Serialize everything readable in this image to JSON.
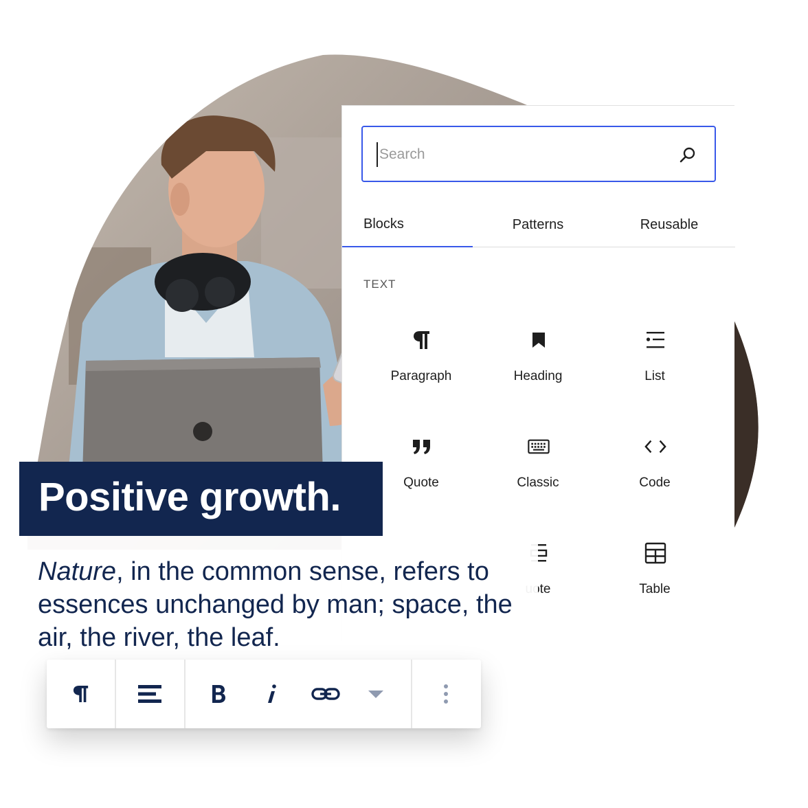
{
  "inserter": {
    "search": {
      "placeholder": "Search",
      "value": ""
    },
    "tabs": [
      {
        "label": "Blocks",
        "active": true
      },
      {
        "label": "Patterns",
        "active": false
      },
      {
        "label": "Reusable",
        "active": false
      }
    ],
    "category": "TEXT",
    "blocks": [
      {
        "label": "Paragraph",
        "icon": "paragraph-icon"
      },
      {
        "label": "Heading",
        "icon": "bookmark-icon"
      },
      {
        "label": "List",
        "icon": "list-icon"
      },
      {
        "label": "Quote",
        "icon": "quote-icon"
      },
      {
        "label": "Classic",
        "icon": "keyboard-icon"
      },
      {
        "label": "Code",
        "icon": "code-icon"
      },
      {
        "label": "uote",
        "icon": "pullquote-icon"
      },
      {
        "label": "Table",
        "icon": "table-icon"
      }
    ]
  },
  "card": {
    "title": "Positive growth.",
    "body_italic": "Nature",
    "body_rest": ", in the common sense, refers to essences unchanged by man; space, the air, the river, the leaf."
  },
  "toolbar": {
    "buttons": [
      "paragraph-icon",
      "align-icon",
      "bold-icon",
      "italic-icon",
      "link-icon",
      "chevron-down-icon",
      "more-vertical-icon"
    ]
  },
  "colors": {
    "accent": "#3858e9",
    "navy": "#12264f",
    "text": "#1e1e1e"
  }
}
